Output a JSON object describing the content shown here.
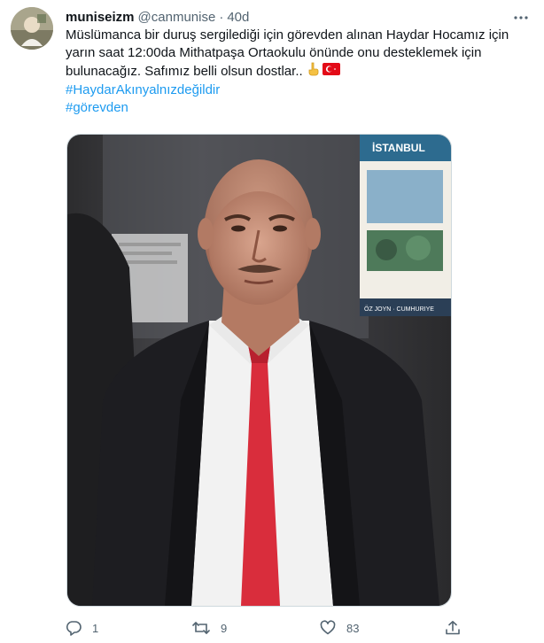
{
  "tweet": {
    "display_name": "muniseizm",
    "handle": "@canmunise",
    "separator": "·",
    "time": "40d",
    "text_lines": [
      "Müslümanca bir duruş sergilediği için görevden alınan Haydar Hocamız için",
      "yarın saat 12:00da Mithatpaşa Ortaokulu önünde onu desteklemek için",
      "bulunacağız. Safımız belli olsun dostlar.."
    ],
    "hashtags": [
      "#HaydarAkınyalnızdeğildir",
      "#görevden"
    ],
    "emojis": [
      "pointing-up-emoji",
      "turkish-flag-emoji"
    ]
  },
  "media": {
    "poster_text": "İSTANBUL",
    "poster_footer": "ÖZ JOYN · CUMHURIYE"
  },
  "actions": {
    "reply_count": "1",
    "retweet_count": "9",
    "like_count": "83"
  },
  "colors": {
    "text": "#0f1419",
    "secondary": "#536471",
    "link": "#1d9bf0",
    "tie": "#d92d3c"
  }
}
